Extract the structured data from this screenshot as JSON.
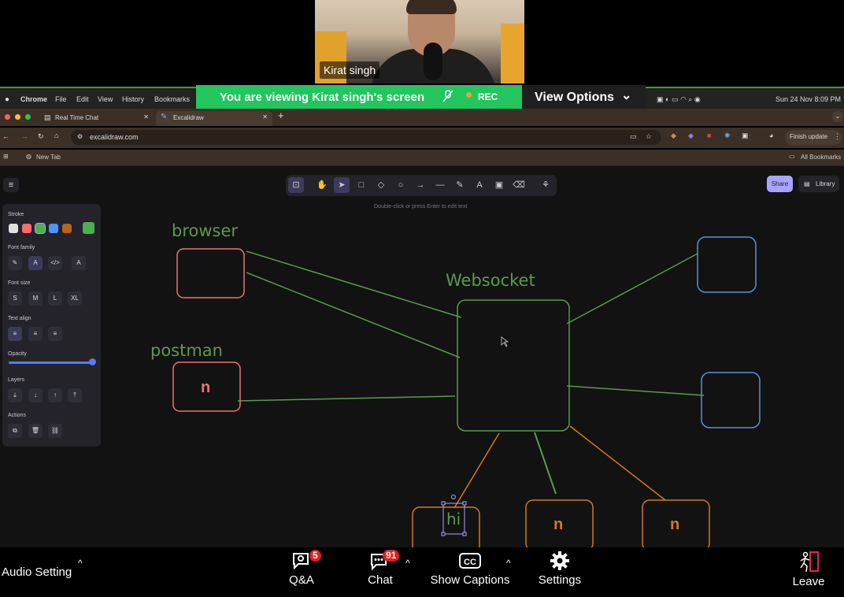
{
  "video": {
    "participant_name": "Kirat singh"
  },
  "menubar": {
    "app": "Chrome",
    "items": [
      "File",
      "Edit",
      "View",
      "History",
      "Bookmarks"
    ],
    "clock": "Sun 24 Nov  8:09 PM"
  },
  "banner": {
    "text": "You are viewing  Kirat singh's screen",
    "rec": "REC",
    "view_options": "View Options"
  },
  "browser": {
    "tabs": [
      {
        "title": "Real Time Chat"
      },
      {
        "title": "Excalidraw"
      }
    ],
    "url": "excalidraw.com",
    "finish_update": "Finish update",
    "bookmark": "New Tab",
    "all_bookmarks": "All Bookmarks"
  },
  "excalidraw": {
    "hint": "Double-click or press Enter to edit text",
    "share": "Share",
    "library": "Library",
    "panel": {
      "stroke": "Stroke",
      "stroke_colors": [
        "#e0e0e0",
        "#ff6b6b",
        "#4caf50",
        "#4d94ff",
        "#b5651d",
        "#4caf50"
      ],
      "font_family": "Font family",
      "font_size": "Font size",
      "sizes": [
        "S",
        "M",
        "L",
        "XL"
      ],
      "text_align": "Text align",
      "opacity": "Opacity",
      "layers": "Layers",
      "actions": "Actions"
    },
    "labels": {
      "browser": "browser",
      "postman": "postman",
      "websocket": "Websocket",
      "postman_box": "n",
      "hi": "hi",
      "box_n1": "n",
      "box_n2": "n"
    },
    "colors": {
      "green": "#5a9a4a",
      "red": "#f07171",
      "blue": "#5a8fe0",
      "orange": "#d27a1a"
    }
  },
  "bottombar": {
    "audio_setting": "Audio Setting",
    "qa": "Q&A",
    "qa_badge": "5",
    "chat": "Chat",
    "chat_badge": "91",
    "captions": "Show Captions",
    "settings": "Settings",
    "leave": "Leave"
  }
}
